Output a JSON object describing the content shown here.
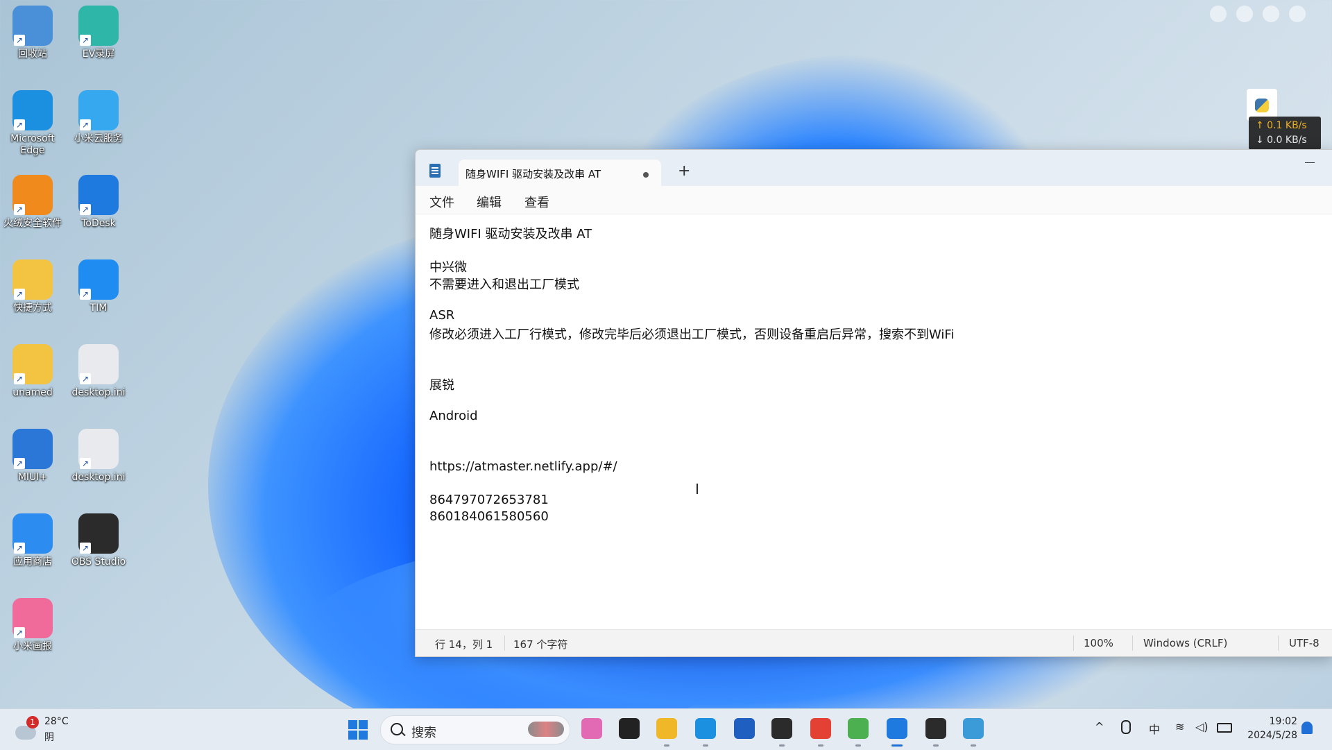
{
  "desktop": {
    "icons": [
      {
        "label": "回收站",
        "icon": "recycle-bin-icon",
        "color": "#4a90d9"
      },
      {
        "label": "EV录屏",
        "icon": "ev-recorder-icon",
        "color": "#2eb6a9"
      },
      {
        "label": "Microsoft Edge",
        "icon": "edge-icon",
        "color": "#1b8fe0"
      },
      {
        "label": "小米云服务",
        "icon": "xiaomi-cloud-icon",
        "color": "#36a8f0"
      },
      {
        "label": "火绒安全软件",
        "icon": "huorong-icon",
        "color": "#f08a1c"
      },
      {
        "label": "ToDesk",
        "icon": "todesk-icon",
        "color": "#1f7ae0"
      },
      {
        "label": "快捷方式",
        "icon": "folder-icon",
        "color": "#f3c342"
      },
      {
        "label": "TIM",
        "icon": "tim-icon",
        "color": "#1e8cf0"
      },
      {
        "label": "unamed",
        "icon": "folder-icon",
        "color": "#f3c342"
      },
      {
        "label": "desktop.ini",
        "icon": "settings-file-icon",
        "color": "#e8eaed"
      },
      {
        "label": "MIUI+",
        "icon": "miui-plus-icon",
        "color": "#2a77d8"
      },
      {
        "label": "desktop.ini",
        "icon": "settings-file-icon",
        "color": "#e8eaed"
      },
      {
        "label": "应用商店",
        "icon": "app-store-icon",
        "color": "#2d8cf0"
      },
      {
        "label": "OBS Studio",
        "icon": "obs-icon",
        "color": "#2b2b2b"
      },
      {
        "label": "小米画报",
        "icon": "xiaomi-pictorial-icon",
        "color": "#f06a9a"
      }
    ],
    "netspeed": {
      "up": "↑ 0.1 KB/s",
      "down": "↓ 0.0 KB/s"
    }
  },
  "notepad": {
    "tab_title": "随身WIFI 驱动安装及改串 AT",
    "new_tab": "+",
    "menu": [
      "文件",
      "编辑",
      "查看"
    ],
    "lines": [
      "随身WIFI 驱动安装及改串 AT",
      "",
      "中兴微",
      "不需要进入和退出工厂模式",
      "",
      "ASR",
      "修改必须进入工厂行模式，修改完毕后必须退出工厂模式，否则设备重启后异常，搜索不到WiFi",
      "",
      "",
      "展锐",
      "",
      "Android",
      "",
      "",
      "https://atmaster.netlify.app/#/",
      "",
      "864797072653781",
      "860184061580560"
    ],
    "status": {
      "position": "行 14，列 1",
      "chars": "167 个字符",
      "zoom": "100%",
      "eol": "Windows (CRLF)",
      "encoding": "UTF-8"
    }
  },
  "taskbar": {
    "weather": {
      "badge": "1",
      "temp": "28°C",
      "condition": "阴"
    },
    "search_placeholder": "搜索",
    "apps": [
      "copilot-icon",
      "task-view-icon",
      "file-explorer-icon",
      "edge-icon",
      "store-icon",
      "terminal-icon",
      "chrome-icon",
      "image-tool-icon",
      "notepad-icon",
      "obs-icon",
      "screen-tool-icon"
    ],
    "tray": {
      "ime": "中"
    },
    "clock": {
      "time": "19:02",
      "date": "2024/5/28"
    }
  }
}
